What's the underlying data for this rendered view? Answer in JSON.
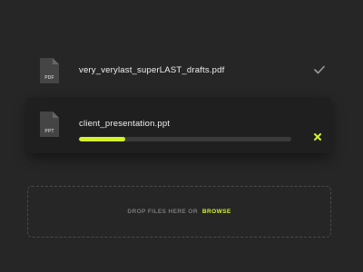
{
  "files": [
    {
      "ext": "PDF",
      "name": "very_verylast_superLAST_drafts.pdf",
      "status": "complete",
      "status_icon": "check-icon"
    },
    {
      "ext": "PPT",
      "name": "client_presentation.ppt",
      "status": "uploading",
      "progress": 0.22,
      "status_icon": "close-icon"
    }
  ],
  "dropzone": {
    "text": "DROP FILES HERE OR",
    "browse_label": "BROWSE"
  },
  "colors": {
    "background": "#262626",
    "card": "#1f1f1f",
    "accent": "#d4f22a",
    "text": "#f1f1f1",
    "muted": "#7a7a7a"
  }
}
